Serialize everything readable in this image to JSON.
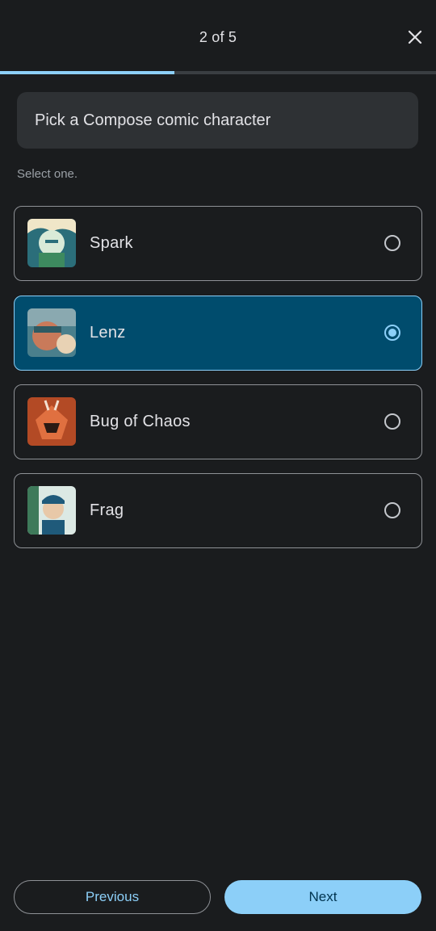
{
  "header": {
    "step_text": "2 of 5",
    "close_icon": "close-icon",
    "progress_fraction": 0.4,
    "progress_color": "#8ccff8"
  },
  "question": {
    "title": "Pick a Compose comic character",
    "hint": "Select one."
  },
  "options": [
    {
      "label": "Spark",
      "selected": false,
      "thumb_colors": [
        "#2b6e7a",
        "#d9ead8",
        "#3d8a5f"
      ]
    },
    {
      "label": "Lenz",
      "selected": true,
      "thumb_colors": [
        "#4a7f8c",
        "#c97a5a",
        "#e8d2b4"
      ]
    },
    {
      "label": "Bug of Chaos",
      "selected": false,
      "thumb_colors": [
        "#b34a25",
        "#e07040",
        "#2a1a14"
      ]
    },
    {
      "label": "Frag",
      "selected": false,
      "thumb_colors": [
        "#1f5a7a",
        "#dce9e4",
        "#3e7a5a"
      ]
    }
  ],
  "footer": {
    "previous_label": "Previous",
    "next_label": "Next"
  },
  "colors": {
    "background": "#1a1c1e",
    "accent": "#8ccff8",
    "selected_fill": "#004c6d"
  }
}
